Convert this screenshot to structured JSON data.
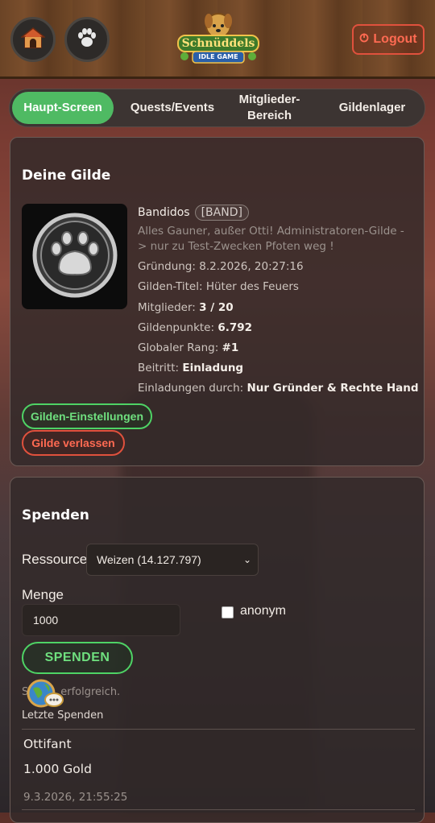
{
  "header": {
    "home_icon": "doghouse-icon",
    "paw_icon": "paw-icon",
    "logo_line1": "Schnüddels",
    "logo_line2": "IDLE GAME",
    "logout_label": "Logout"
  },
  "tabs": [
    {
      "label": "Haupt-Screen",
      "active": true
    },
    {
      "label": "Quests/Events",
      "active": false
    },
    {
      "label": "Mitglieder-Bereich",
      "active": false
    },
    {
      "label": "Gildenlager",
      "active": false
    }
  ],
  "guild": {
    "section_title": "Deine Gilde",
    "name": "Bandidos",
    "tag": "[BAND]",
    "description": "Alles Gauner, außer Otti! Administratoren-Gilde -> nur zu Test-Zwecken Pfoten weg !",
    "founded_label": "Gründung:",
    "founded_value": "8.2.2026, 20:27:16",
    "title_label": "Gilden-Titel:",
    "title_value": "Hüter des Feuers",
    "members_label": "Mitglieder:",
    "members_value": "3 / 20",
    "points_label": "Gildenpunkte:",
    "points_value": "6.792",
    "rank_label": "Globaler Rang:",
    "rank_value": "#1",
    "join_label": "Beitritt:",
    "join_value": "Einladung",
    "invites_label": "Einladungen durch:",
    "invites_value": "Nur Gründer & Rechte Hand",
    "settings_button": "Gilden-Einstellungen",
    "leave_button": "Gilde verlassen"
  },
  "donate": {
    "section_title": "Spenden",
    "resource_label": "Ressource",
    "resource_selected": "Weizen (14.127.797)",
    "amount_label": "Menge",
    "amount_value": "1000",
    "anonymous_label": "anonym",
    "submit_label": "SPENDEN",
    "status_visible_prefix": "S",
    "status_visible_suffix": "erfolgreich.",
    "recent_title": "Letzte Spenden",
    "recent": [
      {
        "name": "Ottifant",
        "amount": "1.000 Gold",
        "time": "9.3.2026, 21:55:25"
      }
    ]
  },
  "colors": {
    "accent_green": "#4fba63",
    "danger_red": "#e0513d"
  }
}
